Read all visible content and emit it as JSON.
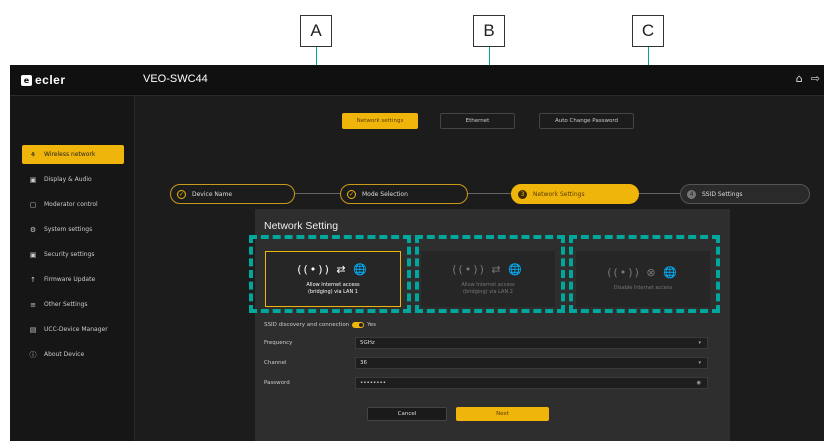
{
  "callouts": {
    "a": "A",
    "b": "B",
    "c": "C"
  },
  "header": {
    "logo": "ecler",
    "device": "VEO-SWC44"
  },
  "sidebar": {
    "items": [
      {
        "label": "Wireless network",
        "icon": "⚘",
        "active": true
      },
      {
        "label": "Display & Audio",
        "icon": "▣"
      },
      {
        "label": "Moderator control",
        "icon": "▢"
      },
      {
        "label": "System settings",
        "icon": "⚙"
      },
      {
        "label": "Security settings",
        "icon": "▣"
      },
      {
        "label": "Firmware Update",
        "icon": "↑"
      },
      {
        "label": "Other Settings",
        "icon": "≡"
      },
      {
        "label": "UCC-Device Manager",
        "icon": "▤"
      },
      {
        "label": "About Device",
        "icon": "ⓘ"
      }
    ]
  },
  "tabs": [
    {
      "label": "Network settings",
      "active": true
    },
    {
      "label": "Ethernet"
    },
    {
      "label": "Auto Change Password"
    }
  ],
  "steps": [
    {
      "label": "Device Name",
      "state": "done",
      "dot": "✓"
    },
    {
      "label": "Mode Selection",
      "state": "done",
      "dot": "✓"
    },
    {
      "label": "Network Settings",
      "state": "current",
      "dot": "3"
    },
    {
      "label": "SSID Settings",
      "state": "todo",
      "dot": "4"
    }
  ],
  "panel": {
    "title": "Network Setting",
    "cards": [
      {
        "icons": "((•)) ⇄ 🌐",
        "label": "Allow Internet access\n(bridging) via LAN 1",
        "selected": true
      },
      {
        "icons": "((•)) ⇄ 🌐",
        "label": "Allow Internet access\n(bridging) via LAN 2"
      },
      {
        "icons": "((•)) ⊗ 🌐",
        "label": "Disable Internet access"
      }
    ],
    "ssid_label": "SSID discovery and connection",
    "ssid_value": "Yes",
    "frequency": {
      "label": "Frequency",
      "value": "5GHz"
    },
    "channel": {
      "label": "Channel",
      "value": "36"
    },
    "password": {
      "label": "Password",
      "value": "••••••••"
    },
    "cancel": "Cancel",
    "next": "Next"
  },
  "colors": {
    "accent": "#f0b50a",
    "callout_line": "#00a79d",
    "background": "#1c1c1c"
  }
}
